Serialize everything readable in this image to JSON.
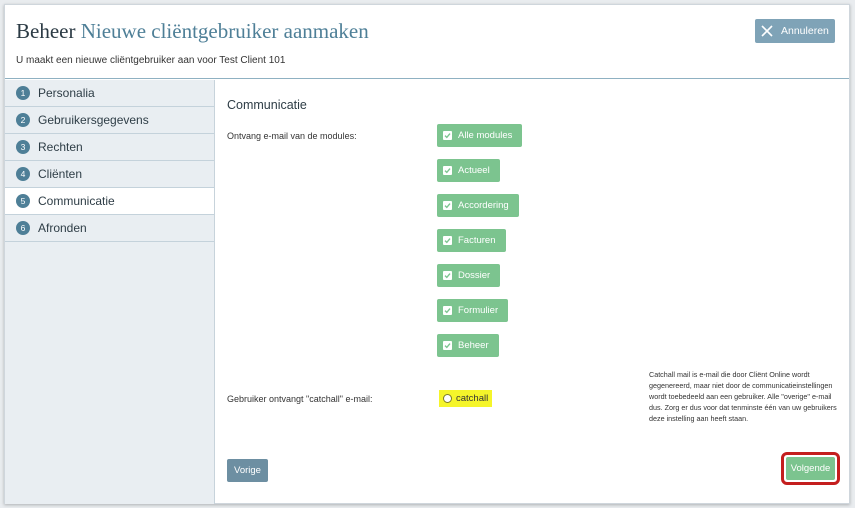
{
  "header": {
    "title_prefix": "Beheer",
    "title_main": "Nieuwe cliëntgebruiker aanmaken",
    "subtitle": "U maakt een nieuwe cliëntgebruiker aan voor Test Client 101",
    "cancel_label": "Annuleren"
  },
  "steps": [
    {
      "num": "1",
      "label": "Personalia"
    },
    {
      "num": "2",
      "label": "Gebruikersgegevens"
    },
    {
      "num": "3",
      "label": "Rechten"
    },
    {
      "num": "4",
      "label": "Cliënten"
    },
    {
      "num": "5",
      "label": "Communicatie"
    },
    {
      "num": "6",
      "label": "Afronden"
    }
  ],
  "content": {
    "section_title": "Communicatie",
    "modules_label": "Ontvang e-mail van de modules:",
    "modules": [
      {
        "label": "Alle modules",
        "checked": true
      },
      {
        "label": "Actueel",
        "checked": true
      },
      {
        "label": "Accordering",
        "checked": true
      },
      {
        "label": "Facturen",
        "checked": true
      },
      {
        "label": "Dossier",
        "checked": true
      },
      {
        "label": "Formulier",
        "checked": true
      },
      {
        "label": "Beheer",
        "checked": true
      }
    ],
    "catchall_label": "Gebruiker ontvangt \"catchall\" e-mail:",
    "catchall_option": "catchall",
    "catchall_note": "Catchall mail is e-mail die door Cliënt Online wordt gegenereerd, maar niet door de communicatieinstellingen wordt toebedeeld aan een gebruiker. Alle \"overige\" e-mail dus. Zorg er dus voor dat tenminste één van uw gebruikers deze instelling aan heeft staan."
  },
  "buttons": {
    "prev_label": "Vorige",
    "next_label": "Volgende"
  },
  "colors": {
    "accent": "#4e7f97",
    "chip_green": "#7cc48f",
    "highlight_yellow": "#f5f52a",
    "annotation_red": "#c41e1e"
  }
}
